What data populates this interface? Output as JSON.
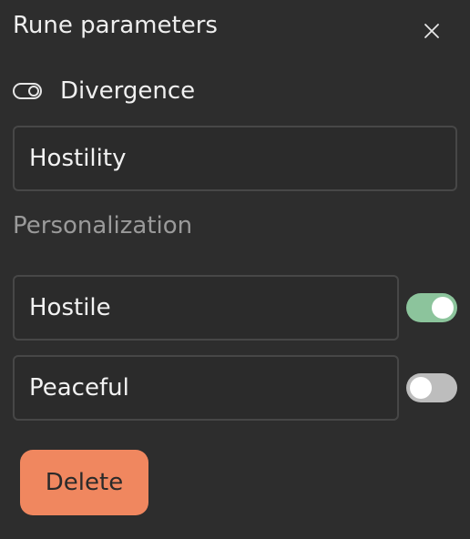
{
  "panel": {
    "title": "Rune parameters",
    "close_icon": "close-icon"
  },
  "rune": {
    "icon": "toggle-outline-icon",
    "name": "Divergence",
    "value": "Hostility"
  },
  "personalization": {
    "title": "Personalization",
    "options": [
      {
        "label": "Hostile",
        "enabled": true
      },
      {
        "label": "Peaceful",
        "enabled": false
      }
    ]
  },
  "actions": {
    "delete_label": "Delete"
  },
  "colors": {
    "background": "#2d2d2d",
    "toggle_on": "#8cc49c",
    "toggle_off": "#bdbdbd",
    "delete": "#f0875f"
  }
}
